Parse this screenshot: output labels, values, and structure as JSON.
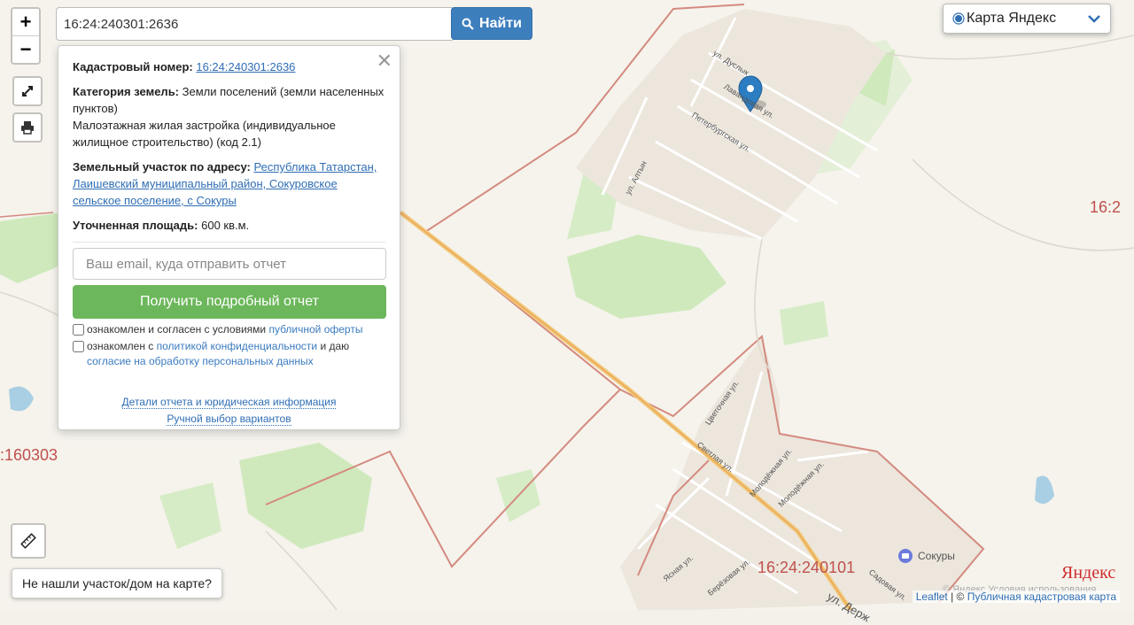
{
  "search": {
    "value": "16:24:240301:2636",
    "button_label": "Найти"
  },
  "zoom": {
    "in_label": "+",
    "out_label": "−"
  },
  "popup": {
    "cadastral_label": "Кадастровый номер:",
    "cadastral_value": "16:24:240301:2636",
    "category_label": "Категория земель:",
    "category_value": "Земли поселений (земли населенных пунктов)",
    "usage_value": "Малоэтажная жилая застройка (индивидуальное жилищное строительство) (код 2.1)",
    "address_label": "Земельный участок по адресу:",
    "address_value": "Республика Татарстан, Лаишевский муниципальный район, Сокуровское сельское поселение, с Сокуры",
    "area_label": "Уточненная площадь:",
    "area_value": "600 кв.м.",
    "email_placeholder": "Ваш email, куда отправить отчет",
    "report_button": "Получить подробный отчет",
    "consent1_text": "ознакомлен и согласен с условиями",
    "consent1_link": "публичной оферты",
    "consent2_text": "ознакомлен с",
    "consent2_link": "политикой конфиденциальности",
    "consent2_mid": "и даю",
    "consent2_link2": "согласие на обработку персональных данных",
    "details_link": "Детали отчета и юридическая информация",
    "manual_link": "Ручной выбор вариантов"
  },
  "layer_select": {
    "value": "Карта Яндекс"
  },
  "not_found_button": "Не нашли участок/дом на карте?",
  "map_labels": {
    "quarter_left": ":160303",
    "quarter_bottom": "16:24:240101",
    "quarter_right": "16:2",
    "village": "Сокуры",
    "yandex_logo": "Яндекс",
    "yandex_terms": "© Яндекс  Условия использования"
  },
  "streets": [
    "ул. Дуслык",
    "Лавандовая ул.",
    "Петербургская ул.",
    "ул. Алтын",
    "Цветочная ул.",
    "Светлая ул.",
    "Молодёжная ул.",
    "Молодёжная ул.",
    "Ясная ул.",
    "Берёзовая ул.",
    "Садовая ул.",
    "ул. Держ"
  ],
  "attribution": {
    "leaflet": "Leaflet",
    "sep": " | © ",
    "source": "Публичная кадастровая карта"
  }
}
